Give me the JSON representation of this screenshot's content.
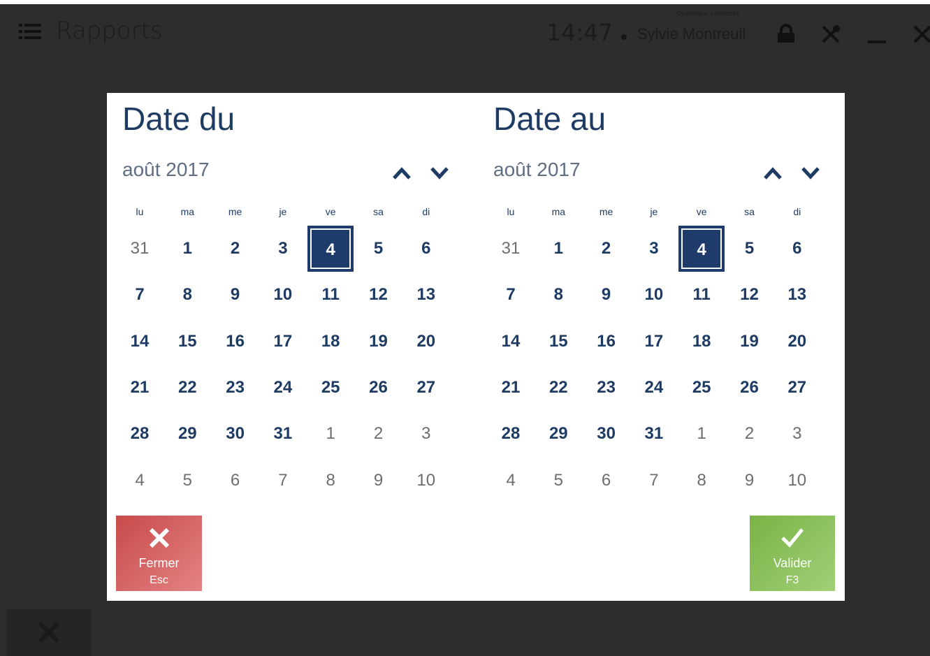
{
  "app": {
    "title": "Rapports",
    "clock": "14:47",
    "operator_label": "Opérateur connecté",
    "operator_name": "Sylvie Montreuil"
  },
  "icons": {
    "menu": "menu-icon",
    "lock": "lock-icon",
    "tools": "tools-icon",
    "minimize": "minimize-icon",
    "close": "close-icon"
  },
  "colors": {
    "accent": "#1e3b63",
    "selected": "#1e3b6c",
    "danger": "#d05656",
    "success": "#8cc15c",
    "overlay": "#2d2d2d"
  },
  "calendars": [
    {
      "title": "Date du",
      "month": "août 2017",
      "weekdays": [
        "lu",
        "ma",
        "me",
        "je",
        "ve",
        "sa",
        "di"
      ],
      "selected": "4",
      "days": [
        "31",
        "1",
        "2",
        "3",
        "4",
        "5",
        "6",
        "7",
        "8",
        "9",
        "10",
        "11",
        "12",
        "13",
        "14",
        "15",
        "16",
        "17",
        "18",
        "19",
        "20",
        "21",
        "22",
        "23",
        "24",
        "25",
        "26",
        "27",
        "28",
        "29",
        "30",
        "31",
        "1",
        "2",
        "3",
        "4",
        "5",
        "6",
        "7",
        "8",
        "9",
        "10"
      ],
      "other_month": [
        true,
        false,
        false,
        false,
        false,
        false,
        false,
        false,
        false,
        false,
        false,
        false,
        false,
        false,
        false,
        false,
        false,
        false,
        false,
        false,
        false,
        false,
        false,
        false,
        false,
        false,
        false,
        false,
        false,
        false,
        false,
        false,
        true,
        true,
        true,
        true,
        true,
        true,
        true,
        true,
        true,
        true
      ]
    },
    {
      "title": "Date au",
      "month": "août 2017",
      "weekdays": [
        "lu",
        "ma",
        "me",
        "je",
        "ve",
        "sa",
        "di"
      ],
      "selected": "4",
      "days": [
        "31",
        "1",
        "2",
        "3",
        "4",
        "5",
        "6",
        "7",
        "8",
        "9",
        "10",
        "11",
        "12",
        "13",
        "14",
        "15",
        "16",
        "17",
        "18",
        "19",
        "20",
        "21",
        "22",
        "23",
        "24",
        "25",
        "26",
        "27",
        "28",
        "29",
        "30",
        "31",
        "1",
        "2",
        "3",
        "4",
        "5",
        "6",
        "7",
        "8",
        "9",
        "10"
      ],
      "other_month": [
        true,
        false,
        false,
        false,
        false,
        false,
        false,
        false,
        false,
        false,
        false,
        false,
        false,
        false,
        false,
        false,
        false,
        false,
        false,
        false,
        false,
        false,
        false,
        false,
        false,
        false,
        false,
        false,
        false,
        false,
        false,
        false,
        true,
        true,
        true,
        true,
        true,
        true,
        true,
        true,
        true,
        true
      ]
    }
  ],
  "buttons": {
    "close_label": "Fermer",
    "close_key": "Esc",
    "ok_label": "Valider",
    "ok_key": "F3"
  }
}
